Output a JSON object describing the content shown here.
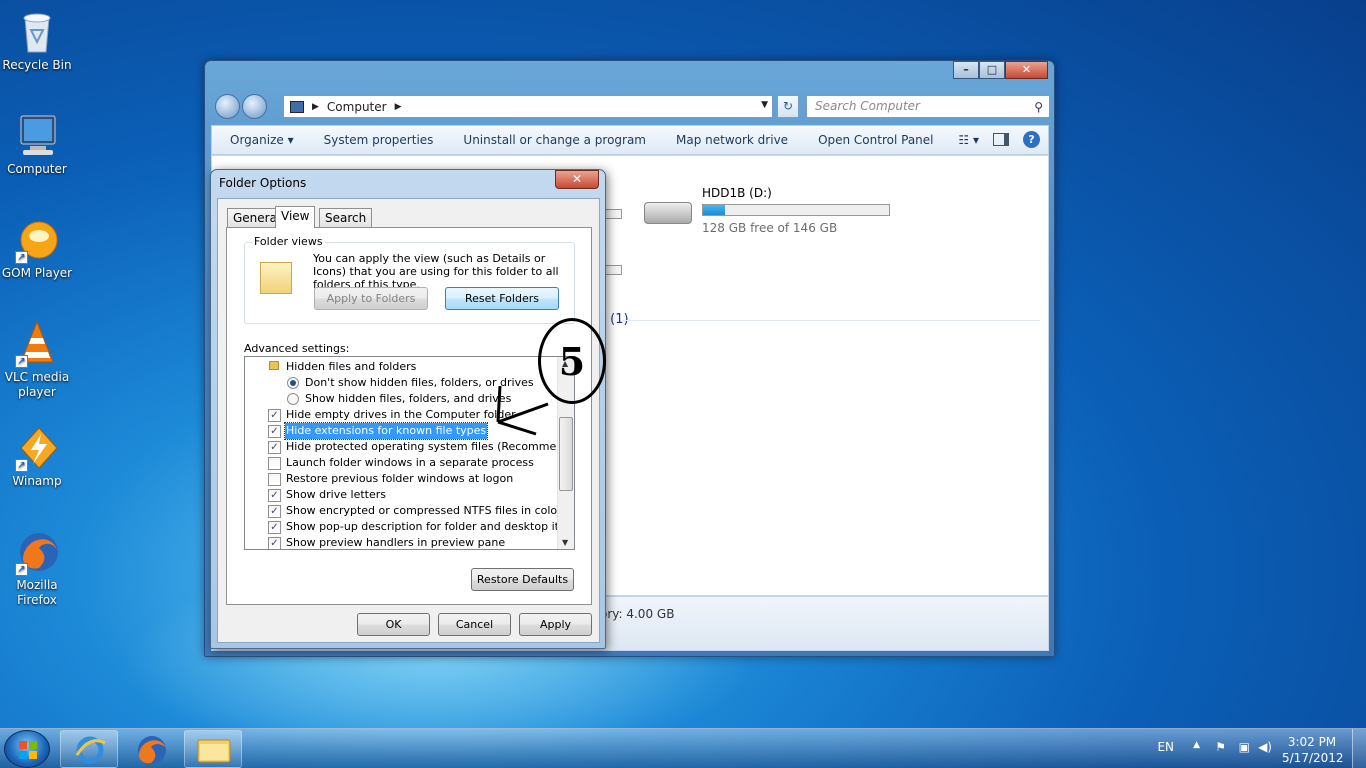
{
  "desktop": {
    "icons": [
      {
        "label": "Recycle Bin",
        "icon": "recycle-bin-icon"
      },
      {
        "label": "Computer",
        "icon": "computer-icon"
      },
      {
        "label": "GOM Player",
        "icon": "gom-player-icon"
      },
      {
        "label": "VLC media player",
        "icon": "vlc-icon"
      },
      {
        "label": "Winamp",
        "icon": "winamp-icon"
      },
      {
        "label": "Mozilla Firefox",
        "icon": "firefox-icon"
      }
    ]
  },
  "explorer": {
    "window_buttons": {
      "minimize": "–",
      "maximize": "□",
      "close": "✕"
    },
    "address": {
      "location": "Computer"
    },
    "search": {
      "placeholder": "Search Computer"
    },
    "toolbar": {
      "organize": "Organize ▾",
      "system_properties": "System properties",
      "uninstall": "Uninstall or change a program",
      "map_drive": "Map network drive",
      "control_panel": "Open Control Panel"
    },
    "drive": {
      "name": "HDD1B (D:)",
      "free_text": "128 GB free of 146 GB",
      "used_fraction": 0.12
    },
    "section_fragment": "e (1)",
    "details_memory": "ory: 4.00 GB"
  },
  "dialog": {
    "title": "Folder Options",
    "tabs": [
      "General",
      "View",
      "Search"
    ],
    "active_tab": "View",
    "folder_views": {
      "label": "Folder views",
      "description": "You can apply the view (such as Details or Icons) that you are using for this folder to all folders of this type.",
      "apply_button": "Apply to Folders",
      "reset_button": "Reset Folders"
    },
    "advanced_label": "Advanced settings:",
    "settings": [
      {
        "type": "folder",
        "label": "Hidden files and folders"
      },
      {
        "type": "radio",
        "label": "Don't show hidden files, folders, or drives",
        "checked": true
      },
      {
        "type": "radio",
        "label": "Show hidden files, folders, and drives",
        "checked": false
      },
      {
        "type": "check",
        "label": "Hide empty drives in the Computer folder",
        "checked": true
      },
      {
        "type": "check",
        "label": "Hide extensions for known file types",
        "checked": true,
        "selected": true
      },
      {
        "type": "check",
        "label": "Hide protected operating system files (Recommended)",
        "checked": true
      },
      {
        "type": "check",
        "label": "Launch folder windows in a separate process",
        "checked": false
      },
      {
        "type": "check",
        "label": "Restore previous folder windows at logon",
        "checked": false
      },
      {
        "type": "check",
        "label": "Show drive letters",
        "checked": true
      },
      {
        "type": "check",
        "label": "Show encrypted or compressed NTFS files in color",
        "checked": true
      },
      {
        "type": "check",
        "label": "Show pop-up description for folder and desktop items",
        "checked": true
      },
      {
        "type": "check",
        "label": "Show preview handlers in preview pane",
        "checked": true
      }
    ],
    "restore_defaults": "Restore Defaults",
    "buttons": {
      "ok": "OK",
      "cancel": "Cancel",
      "apply": "Apply"
    },
    "close": "✕"
  },
  "annotation": {
    "step": "5"
  },
  "taskbar": {
    "apps": [
      "internet-explorer-icon",
      "firefox-icon",
      "windows-explorer-icon"
    ],
    "language": "EN",
    "time": "3:02 PM",
    "date": "5/17/2012"
  }
}
